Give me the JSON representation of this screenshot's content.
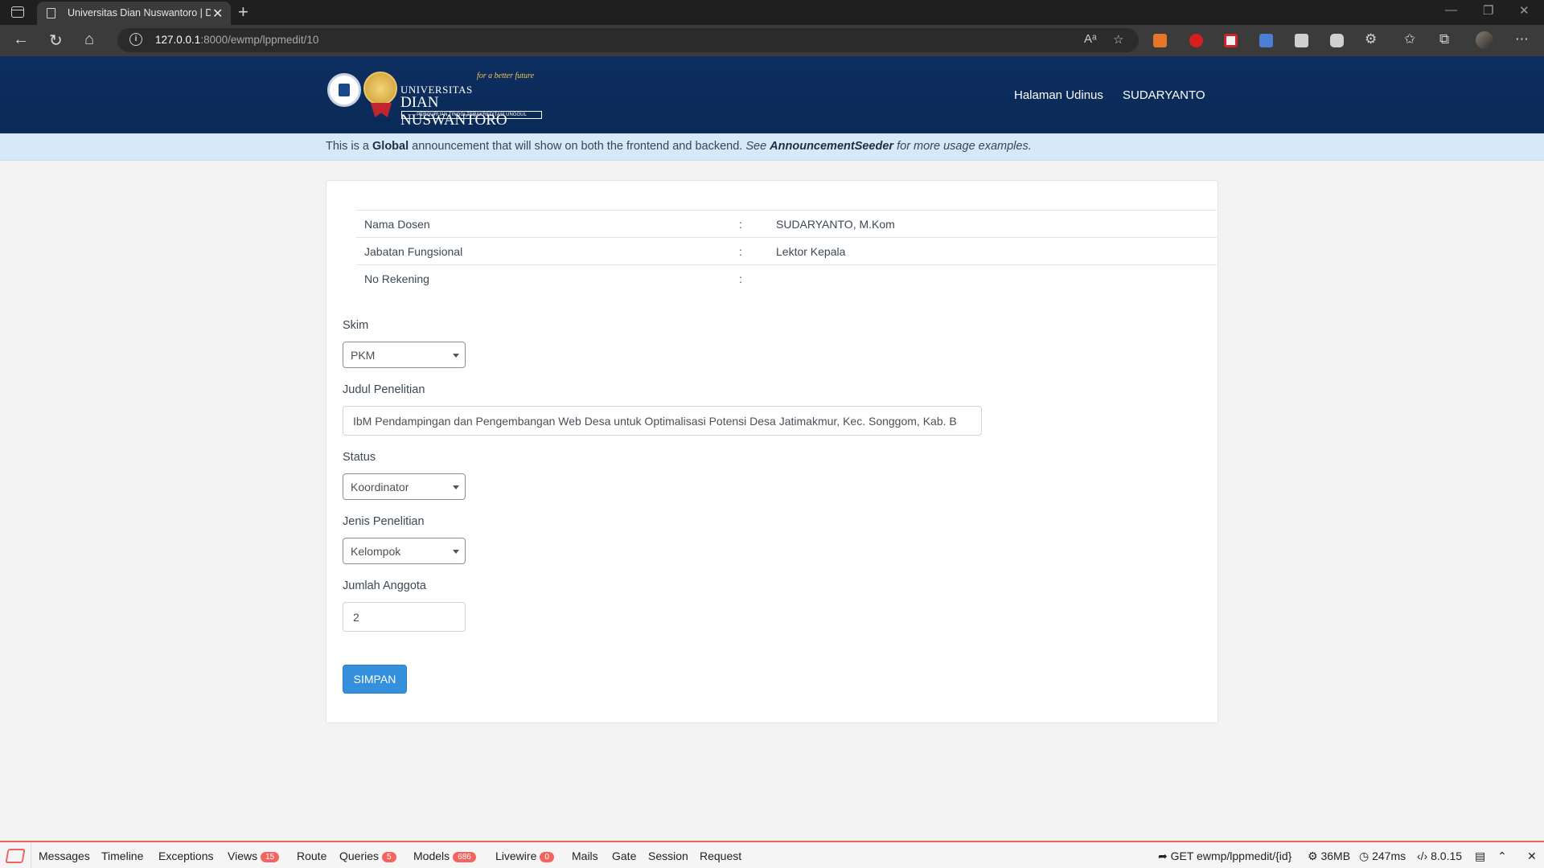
{
  "browser": {
    "tab_title": "Universitas Dian Nuswantoro | D",
    "url_host": "127.0.0.1",
    "url_path": ":8000/ewmp/lppmedit/10"
  },
  "header": {
    "logo_line1": "UNIVERSITAS",
    "logo_line2": "DIAN NUSWANTORO",
    "logo_tagline": "for a better future",
    "logo_bar": "PERGURUAN TINGGI TERAKREDITASI UNGGUL",
    "nav_home": "Halaman Udinus",
    "nav_user": "SUDARYANTO"
  },
  "announcement": {
    "prefix": "This is a ",
    "bold": "Global",
    "middle": " announcement that will show on both the frontend and backend. ",
    "italic1": "See ",
    "italic_bold": "AnnouncementSeeder",
    "italic2": " for more usage examples."
  },
  "info": {
    "rows": [
      {
        "label": "Nama Dosen",
        "sep": ":",
        "value": "SUDARYANTO, M.Kom"
      },
      {
        "label": "Jabatan Fungsional",
        "sep": ":",
        "value": "Lektor Kepala"
      },
      {
        "label": "No Rekening",
        "sep": ":",
        "value": ""
      }
    ]
  },
  "form": {
    "skim_label": "Skim",
    "skim_value": "PKM",
    "judul_label": "Judul Penelitian",
    "judul_value": "IbM Pendampingan dan Pengembangan Web Desa untuk Optimalisasi Potensi Desa Jatimakmur, Kec. Songgom, Kab. B",
    "status_label": "Status",
    "status_value": "Koordinator",
    "jenis_label": "Jenis Penelitian",
    "jenis_value": "Kelompok",
    "jumlah_label": "Jumlah Anggota",
    "jumlah_value": "2",
    "save_label": "SIMPAN"
  },
  "debugbar": {
    "messages": "Messages",
    "timeline": "Timeline",
    "exceptions": "Exceptions",
    "views": "Views",
    "views_count": "15",
    "route": "Route",
    "queries": "Queries",
    "queries_count": "5",
    "models": "Models",
    "models_count": "686",
    "livewire": "Livewire",
    "livewire_count": "0",
    "mails": "Mails",
    "gate": "Gate",
    "session": "Session",
    "request": "Request",
    "route_info": "GET ewmp/lppmedit/{id}",
    "memory": "36MB",
    "time": "247ms",
    "php_version": "8.0.15"
  },
  "colors": {
    "header_bg": "#0a2a57",
    "announcement_bg": "#d6e9f8",
    "primary_button": "#3490dc",
    "debug_accent": "#f4645f"
  }
}
